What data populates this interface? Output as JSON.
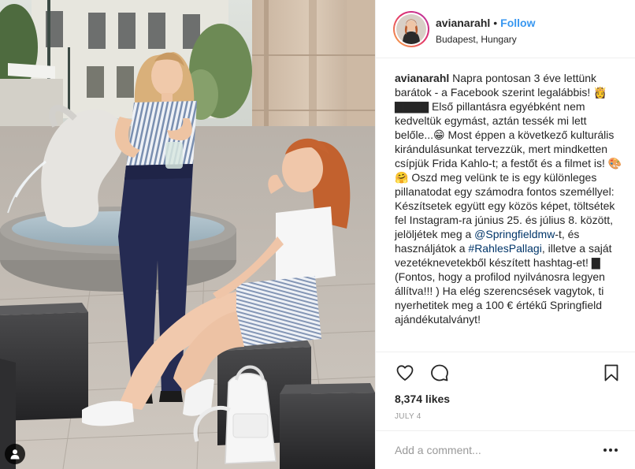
{
  "post": {
    "username": "avianarahl",
    "separator": "•",
    "follow_label": "Follow",
    "location": "Budapest, Hungary",
    "caption": {
      "username": "avianarahl",
      "segments": [
        {
          "type": "text",
          "text": "Napra pontosan 3 éve lettünk barátok - a Facebook szerint legalábbis! 👸 ▇▇▇▇ Első pillantásra egyébként nem kedveltük egymást, aztán tessék mi lett belőle...😁 Most éppen a következő kulturális kirándulásunkat tervezzük, mert mindketten csípjük Frida Kahlo-t; a festőt és a filmet is! 🎨🤗 Oszd meg velünk te is egy különleges pillanatodat egy számodra fontos személlyel: Készítsetek együtt egy közös képet, töltsétek fel Instagram-ra június 25. és július 8. között, jelöljétek meg a "
        },
        {
          "type": "link",
          "text": "@Springfieldmw"
        },
        {
          "type": "text",
          "text": "-t, és használjátok a "
        },
        {
          "type": "link",
          "text": "#RahlesPallagi"
        },
        {
          "type": "text",
          "text": ", illetve a saját vezetéknevetekből készített hashtag-et! ▇ (Fontos, hogy a profilod nyilvánosra legyen állítva!!! ) Ha elég szerencsések vagytok, ti nyerhetitek meg a 100 € értékű Springfield ajándékutalványt!"
        }
      ]
    },
    "likes": "8,374 likes",
    "date": "JULY 4",
    "comment_placeholder": "Add a comment..."
  },
  "icons": {
    "like": "heart-icon",
    "comment": "comment-bubble-icon",
    "save": "bookmark-icon",
    "more": "more-options-icon",
    "tag": "user-tag-icon"
  },
  "colors": {
    "follow": "#3897f0",
    "link": "#003569",
    "muted": "#999999",
    "text": "#262626",
    "divider": "#efefef"
  }
}
